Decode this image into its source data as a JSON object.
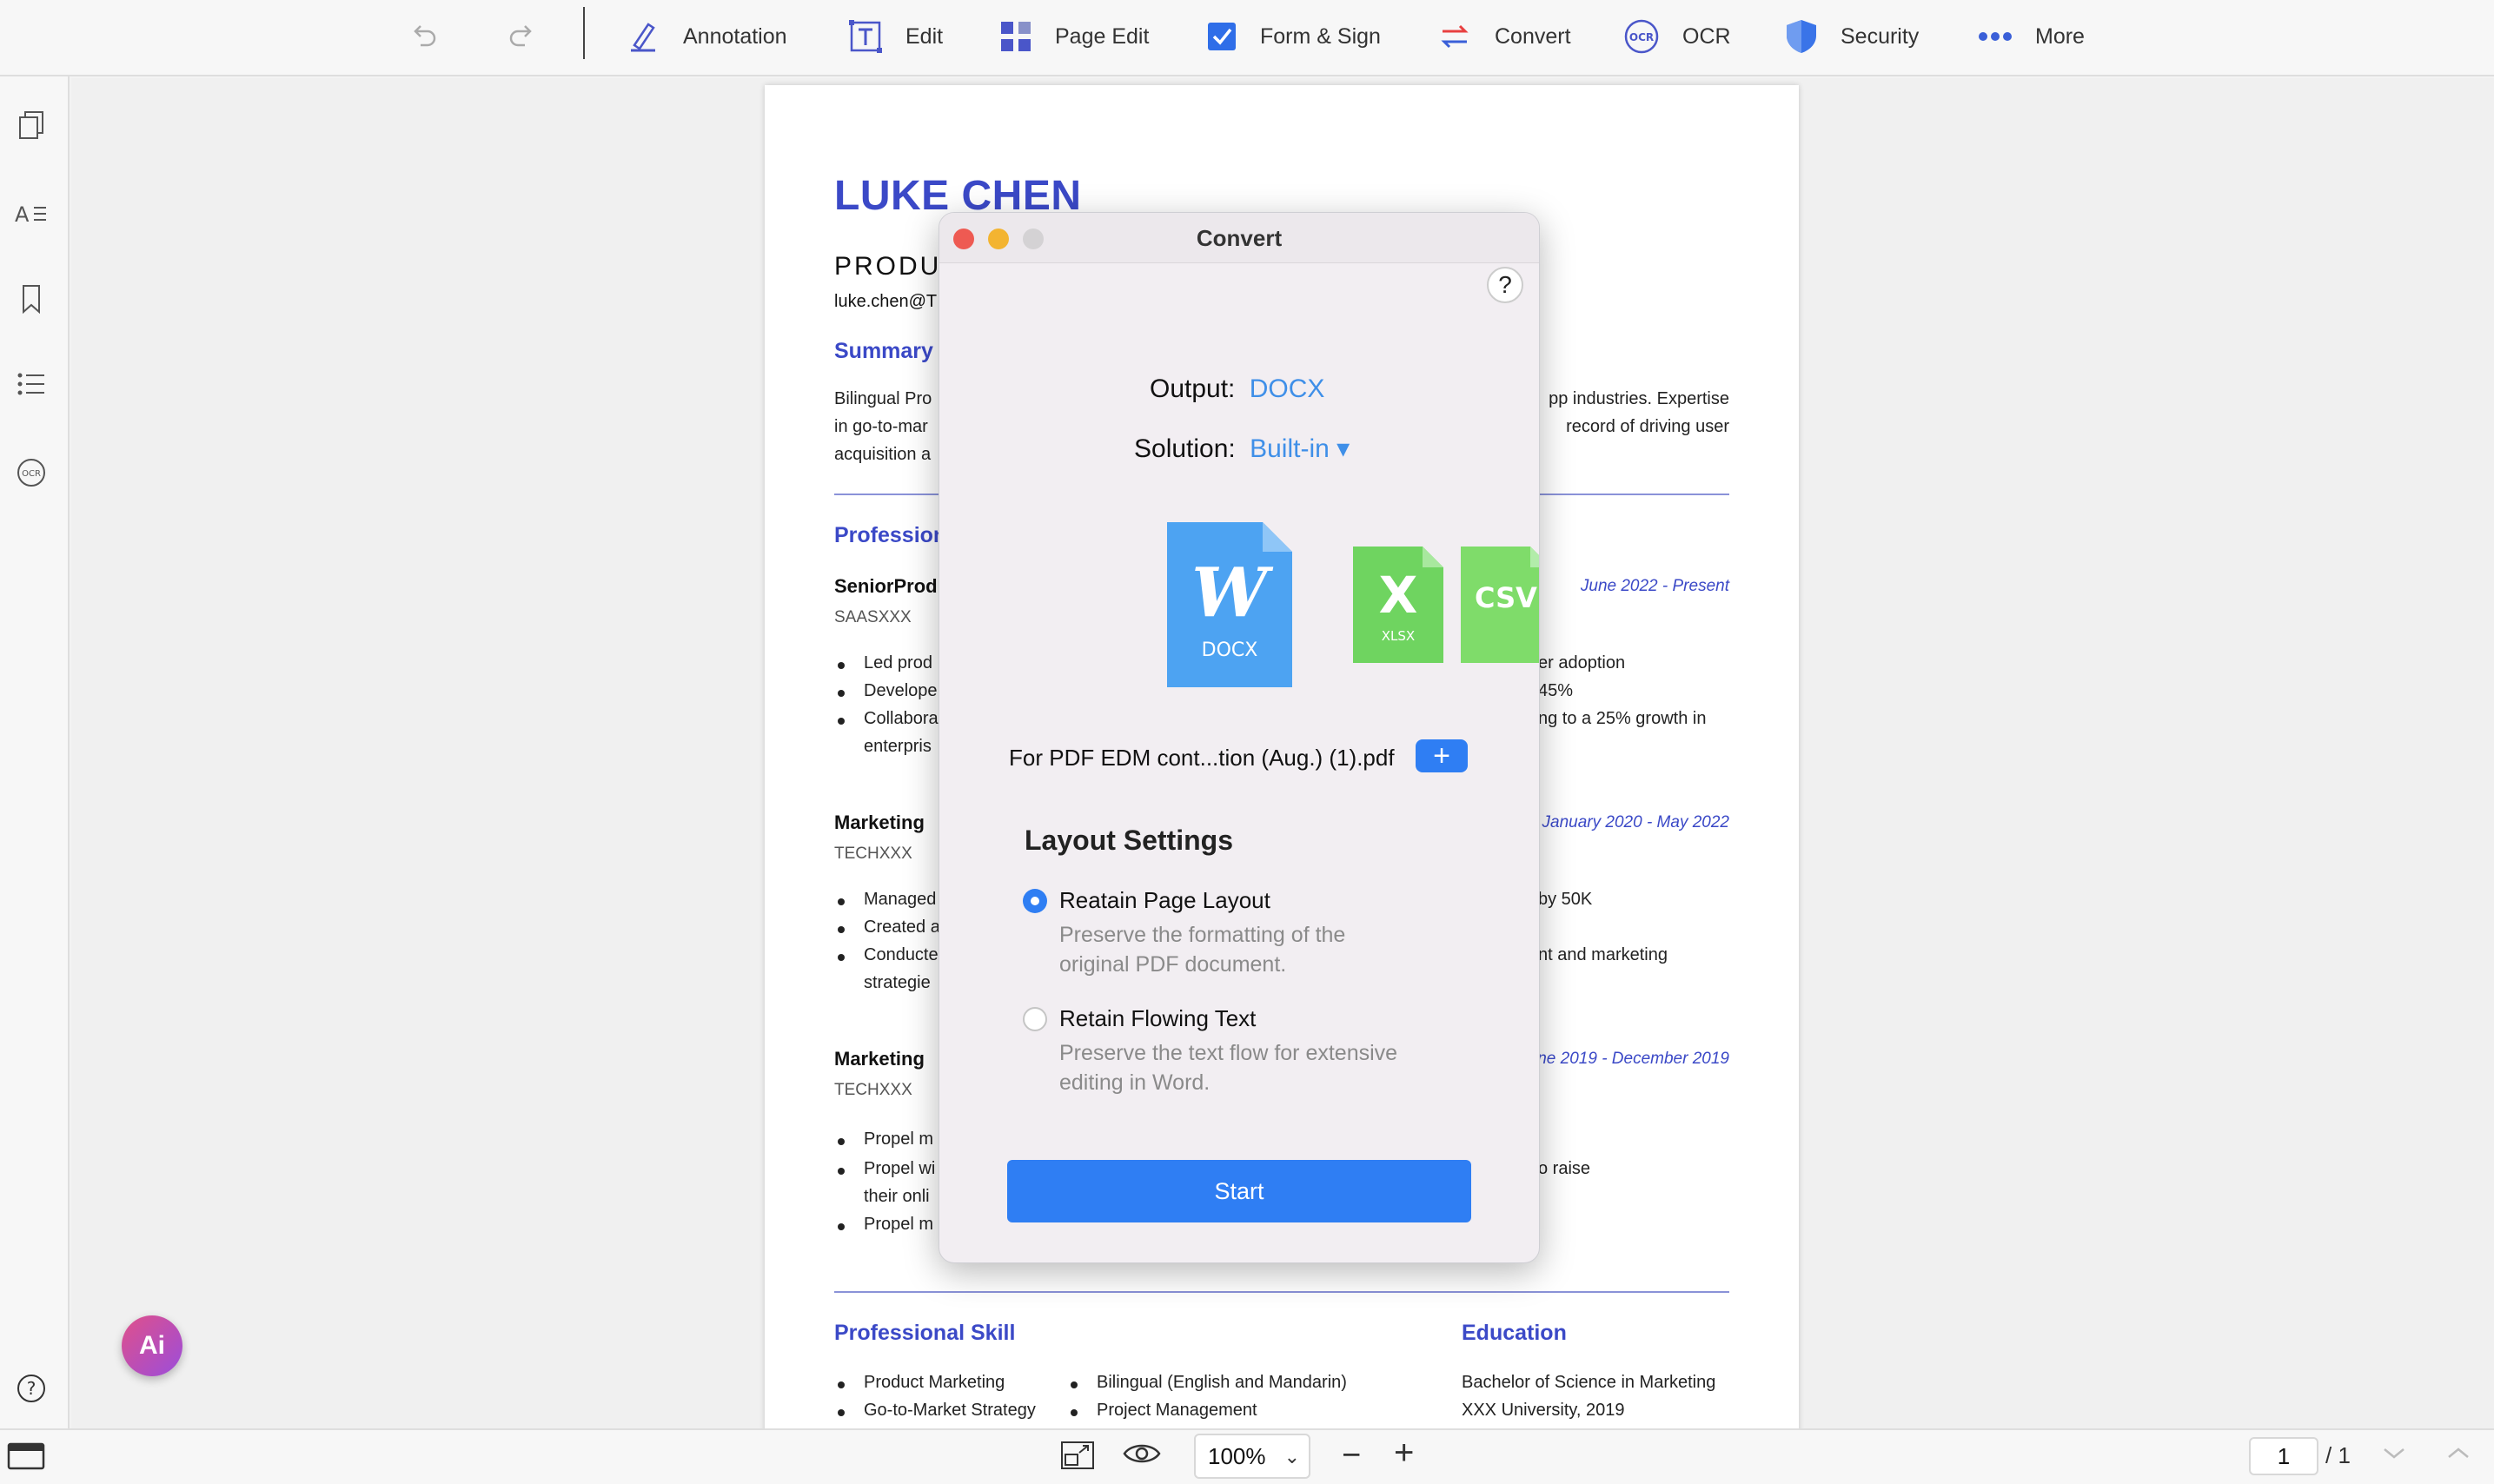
{
  "toolbar": {
    "items": [
      {
        "label": "Annotation",
        "icon": "pen-icon"
      },
      {
        "label": "Edit",
        "icon": "text-edit-icon"
      },
      {
        "label": "Page Edit",
        "icon": "grid-icon"
      },
      {
        "label": "Form & Sign",
        "icon": "checkbox-icon"
      },
      {
        "label": "Convert",
        "icon": "convert-arrows-icon"
      },
      {
        "label": "OCR",
        "icon": "ocr-icon"
      },
      {
        "label": "Security",
        "icon": "shield-icon"
      },
      {
        "label": "More",
        "icon": "more-dots-icon"
      }
    ]
  },
  "document": {
    "name": "LUKE CHEN",
    "role_partial": "PRODU",
    "email_partial": "luke.chen@T",
    "summary": {
      "heading": "Summary",
      "left_lines": [
        "Bilingual Pro",
        "in  go-to-mar",
        "acquisition a"
      ],
      "right_lines": [
        "pp industries. Expertise",
        "record  of  driving  user",
        ""
      ]
    },
    "professional_heading": "Profession",
    "jobs": [
      {
        "title": "SeniorProd",
        "company": "SAASXXX",
        "date": "June 2022 - Present",
        "bullets_left": [
          "Led prod",
          "Develope",
          "Collabora",
          "enterpris"
        ],
        "bullets_right": [
          "er adoption",
          "45%",
          "ng to a 25% growth in",
          ""
        ]
      },
      {
        "title": "Marketing",
        "company": "TECHXXX",
        "date": "January 2020 - May 2022",
        "bullets_left": [
          "Managed",
          "Created a",
          "Conducte",
          "strategie"
        ],
        "bullets_right": [
          "by 50K",
          "",
          "nt and marketing",
          ""
        ]
      },
      {
        "title": "Marketing",
        "company": "TECHXXX",
        "date": "ne 2019 - December 2019",
        "bullets_left": [
          "Propel m",
          "Propel wi",
          "their onli",
          "Propel m"
        ],
        "bullets_right": [
          "",
          "o raise",
          "",
          ""
        ]
      }
    ],
    "skill_heading": "Professional Skill",
    "skills_col1": [
      "Product Marketing",
      "Go-to-Market Strategy"
    ],
    "skills_col2": [
      "Bilingual (English and Mandarin)",
      "Project Management"
    ],
    "education_heading": "Education",
    "education_lines": [
      "Bachelor of Science in Marketing",
      "XXX University, 2019"
    ]
  },
  "dialog": {
    "title": "Convert",
    "help_label": "?",
    "output_label": "Output:",
    "output_value": "DOCX",
    "solution_label": "Solution:",
    "solution_value": "Built-in",
    "solution_arrow": "▾",
    "formats": [
      {
        "badge": "W",
        "label": "DOCX",
        "color": "#4a9ff0"
      },
      {
        "badge": "X",
        "label": "XLSX",
        "color": "#6fd460"
      },
      {
        "badge": "CSV",
        "label": "",
        "color": "#7fdc6a"
      }
    ],
    "file_name": "For PDF EDM cont...tion (Aug.)  (1).pdf",
    "add_file_label": "+",
    "layout_heading": "Layout Settings",
    "options": [
      {
        "title": "Reatain Page Layout",
        "desc1": "Preserve the formatting of the",
        "desc2": "original PDF document.",
        "selected": true
      },
      {
        "title": "Retain Flowing Text",
        "desc1": "Preserve the text flow for extensive",
        "desc2": "editing in Word.",
        "selected": false
      }
    ],
    "start_label": "Start"
  },
  "ai_fab_label": "Ai",
  "bottombar": {
    "zoom_value": "100%",
    "zoom_minus": "−",
    "zoom_plus": "+",
    "page_current": "1",
    "page_total": "/ 1"
  },
  "colors": {
    "accent": "#2f7ef3",
    "doc_heading": "#3b49c7"
  }
}
